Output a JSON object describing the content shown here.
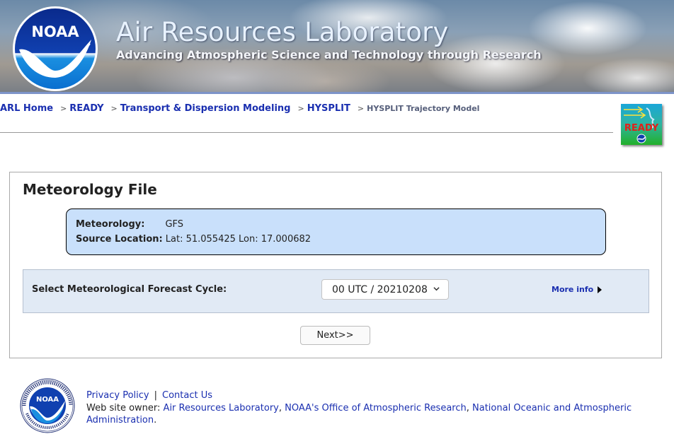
{
  "header": {
    "title": "Air Resources Laboratory",
    "subtitle": "Advancing Atmospheric Science and Technology through Research",
    "logo_text": "NOAA",
    "ready_logo_text": "READY"
  },
  "breadcrumb": {
    "items": [
      {
        "label": "ARL Home"
      },
      {
        "label": "READY"
      },
      {
        "label": "Transport & Dispersion Modeling"
      },
      {
        "label": "HYSPLIT"
      }
    ],
    "separator": ">",
    "current": "HYSPLIT Trajectory Model"
  },
  "panel": {
    "title": "Meteorology File",
    "info": {
      "meteorology_label": "Meteorology:",
      "meteorology_value": "GFS",
      "source_label": "Source Location:",
      "source_value": "Lat: 51.055425 Lon: 17.000682"
    },
    "cycle": {
      "label": "Select Meteorological Forecast Cycle:",
      "selected": "00 UTC / 20210208",
      "more_info": "More info"
    },
    "next_label": "Next>>"
  },
  "footer": {
    "seal_text": "NOAA",
    "privacy": "Privacy Policy",
    "pipe": "|",
    "contact": "Contact Us",
    "owner_prefix": "Web site owner: ",
    "owner_arl": "Air Resources Laboratory",
    "owner_sep": ", ",
    "owner_oar": "NOAA's Office of Atmospheric Research",
    "owner_sep2": ", ",
    "owner_noaa": "National Oceanic and Atmospheric Administration",
    "owner_end": "."
  },
  "colors": {
    "link": "#1a2fb0",
    "info_box": "#c9e0fb",
    "cycle_bar": "#e1eaf5",
    "banner_rule": "#7d94c9"
  }
}
